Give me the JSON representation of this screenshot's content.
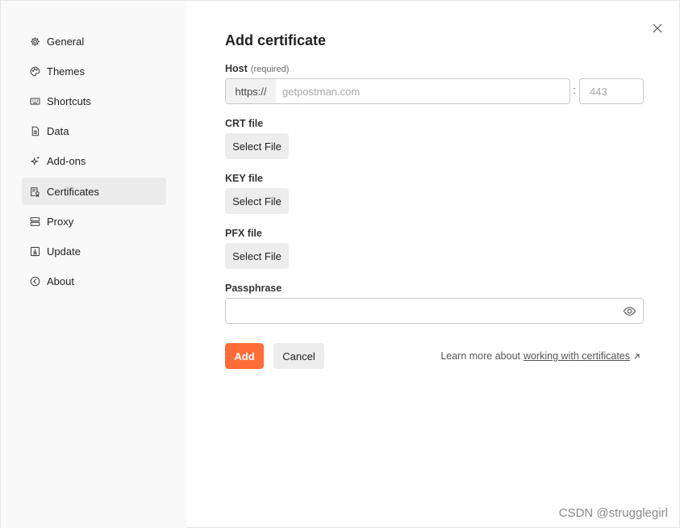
{
  "sidebar": {
    "items": [
      {
        "label": "General",
        "icon": "gear-icon",
        "active": false
      },
      {
        "label": "Themes",
        "icon": "palette-icon",
        "active": false
      },
      {
        "label": "Shortcuts",
        "icon": "keyboard-icon",
        "active": false
      },
      {
        "label": "Data",
        "icon": "database-icon",
        "active": false
      },
      {
        "label": "Add-ons",
        "icon": "sparkle-icon",
        "active": false
      },
      {
        "label": "Certificates",
        "icon": "certificate-icon",
        "active": true
      },
      {
        "label": "Proxy",
        "icon": "server-icon",
        "active": false
      },
      {
        "label": "Update",
        "icon": "download-icon",
        "active": false
      },
      {
        "label": "About",
        "icon": "info-circle-icon",
        "active": false
      }
    ]
  },
  "dialog": {
    "title": "Add certificate",
    "host": {
      "label": "Host",
      "hint": "(required)",
      "prefix": "https://",
      "placeholder": "getpostman.com",
      "separator": ":",
      "port_placeholder": "443"
    },
    "crt": {
      "label": "CRT file",
      "button": "Select File"
    },
    "key": {
      "label": "KEY file",
      "button": "Select File"
    },
    "pfx": {
      "label": "PFX file",
      "button": "Select File"
    },
    "passphrase": {
      "label": "Passphrase",
      "value": ""
    },
    "add_label": "Add",
    "cancel_label": "Cancel",
    "learn_more_text": "Learn more about",
    "learn_more_link": "working with certificates"
  },
  "watermark": "CSDN @strugglegirl",
  "colors": {
    "accent": "#ff6c37",
    "sidebar_bg": "#f9f9f9",
    "active_item_bg": "#ebebeb"
  }
}
